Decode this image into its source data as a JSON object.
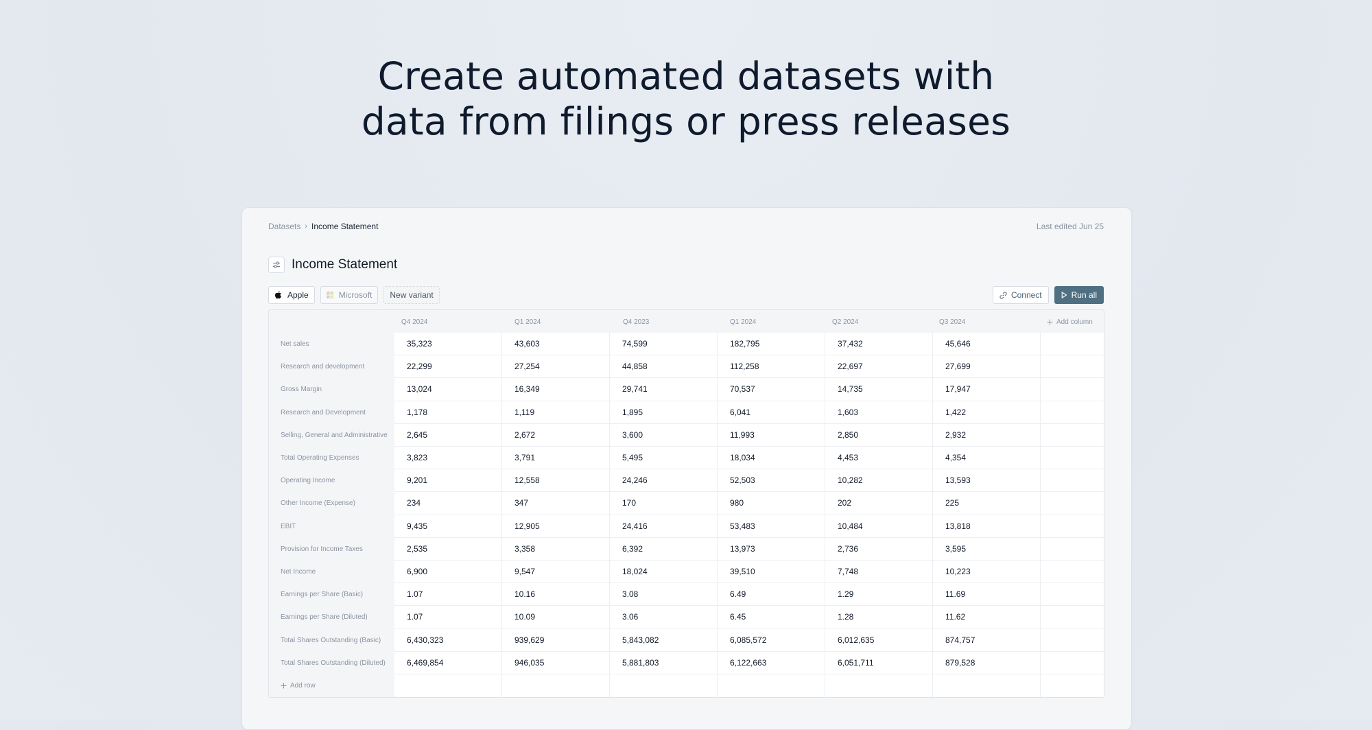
{
  "hero": {
    "line1": "Create automated datasets with",
    "line2": "data from filings or press releases"
  },
  "breadcrumb": {
    "root": "Datasets",
    "separator": "›",
    "current": "Income Statement"
  },
  "last_edited": "Last edited Jun 25",
  "page_title": "Income Statement",
  "tabs": [
    {
      "label": "Apple",
      "icon": "apple-icon",
      "active": true
    },
    {
      "label": "Microsoft",
      "icon": "microsoft-icon",
      "active": false
    },
    {
      "label": "New variant",
      "icon": "",
      "active": false
    }
  ],
  "actions": {
    "connect_label": "Connect",
    "run_label": "Run all"
  },
  "colors": {
    "run_button": "#4f7082",
    "background": "#e5eaf0",
    "card": "#f5f6f8"
  },
  "table": {
    "columns": [
      "Q4 2024",
      "Q1 2024",
      "Q4 2023",
      "Q1 2024",
      "Q2 2024",
      "Q3 2024"
    ],
    "add_column_label": "Add column",
    "add_row_label": "Add row",
    "rows": [
      {
        "label": "Net sales",
        "values": [
          "35,323",
          "43,603",
          "74,599",
          "182,795",
          "37,432",
          "45,646"
        ]
      },
      {
        "label": "Research and development",
        "values": [
          "22,299",
          "27,254",
          "44,858",
          "112,258",
          "22,697",
          "27,699"
        ]
      },
      {
        "label": "Gross Margin",
        "values": [
          "13,024",
          "16,349",
          "29,741",
          "70,537",
          "14,735",
          "17,947"
        ]
      },
      {
        "label": "Research and Development",
        "values": [
          "1,178",
          "1,119",
          "1,895",
          "6,041",
          "1,603",
          "1,422"
        ]
      },
      {
        "label": "Selling, General and Administrative",
        "values": [
          "2,645",
          "2,672",
          "3,600",
          "11,993",
          "2,850",
          "2,932"
        ]
      },
      {
        "label": "Total Operating Expenses",
        "values": [
          "3,823",
          "3,791",
          "5,495",
          "18,034",
          "4,453",
          "4,354"
        ]
      },
      {
        "label": "Operating Income",
        "values": [
          "9,201",
          "12,558",
          "24,246",
          "52,503",
          "10,282",
          "13,593"
        ]
      },
      {
        "label": "Other Income (Expense)",
        "values": [
          "234",
          "347",
          "170",
          "980",
          "202",
          "225"
        ]
      },
      {
        "label": "EBIT",
        "values": [
          "9,435",
          "12,905",
          "24,416",
          "53,483",
          "10,484",
          "13,818"
        ]
      },
      {
        "label": "Provision for Income Taxes",
        "values": [
          "2,535",
          "3,358",
          "6,392",
          "13,973",
          "2,736",
          "3,595"
        ]
      },
      {
        "label": "Net Income",
        "values": [
          "6,900",
          "9,547",
          "18,024",
          "39,510",
          "7,748",
          "10,223"
        ]
      },
      {
        "label": "Earnings per Share (Basic)",
        "values": [
          "1.07",
          "10.16",
          "3.08",
          "6.49",
          "1.29",
          "11.69"
        ]
      },
      {
        "label": "Earnings per Share (Diluted)",
        "values": [
          "1.07",
          "10.09",
          "3.06",
          "6.45",
          "1.28",
          "11.62"
        ]
      },
      {
        "label": "Total Shares Outstanding (Basic)",
        "values": [
          "6,430,323",
          "939,629",
          "5,843,082",
          "6,085,572",
          "6,012,635",
          "874,757"
        ]
      },
      {
        "label": "Total Shares Outstanding (Diluted)",
        "values": [
          "6,469,854",
          "946,035",
          "5,881,803",
          "6,122,663",
          "6,051,711",
          "879,528"
        ]
      }
    ]
  }
}
